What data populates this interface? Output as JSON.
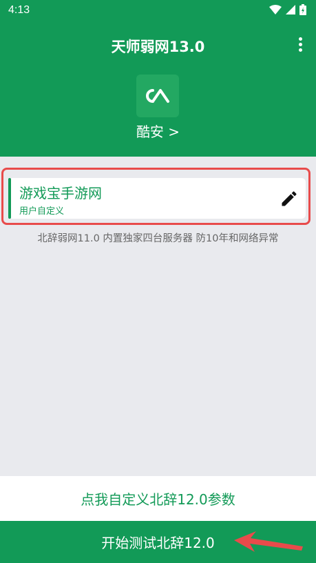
{
  "status": {
    "time": "4:13"
  },
  "header": {
    "title": "天师弱网13.0",
    "app_name": "酷安 >"
  },
  "card": {
    "title": "游戏宝手游网",
    "subtitle": "用户自定义"
  },
  "info": "北辞弱网11.0 内置独家四台服务器 防10年和网络异常",
  "custom_button": "点我自定义北辞12.0参数",
  "start_button": "开始测试北辞12.0",
  "colors": {
    "primary": "#129a57",
    "highlight": "#e84b4b",
    "background": "#e9eaee"
  },
  "icons": [
    "wifi-icon",
    "signal-icon",
    "battery-icon",
    "more-vert-icon",
    "coolapk-logo-icon",
    "edit-pencil-icon",
    "arrow-annotation-icon"
  ]
}
